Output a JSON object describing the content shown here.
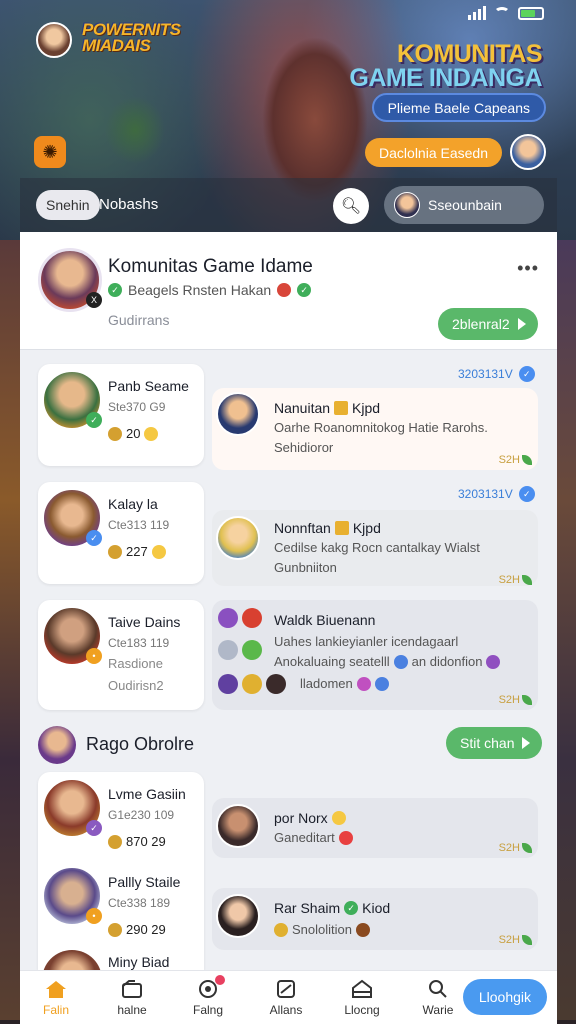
{
  "header": {
    "logo": "POWERNITS MIADAIS",
    "title_line1": "KOMUNITAS",
    "title_line2": "GAME INDANGA",
    "pill_blue": "Plieme Baele Capeans",
    "pill_orange": "Daclolnia Easedn"
  },
  "search": {
    "chip": "Snehin",
    "text": "Nobashs",
    "pill": "Sseounbain"
  },
  "group": {
    "title": "Komunitas Game Idame",
    "subtitle": "Beagels Rnsten Hakan",
    "category": "Gudirrans",
    "button": "2blenral2"
  },
  "members": [
    {
      "name": "Panb Seame",
      "meta": "Ste370 G9",
      "stat": "20"
    },
    {
      "name": "Kalay la",
      "meta": "Cte313 119",
      "stat": "227"
    },
    {
      "name": "Taive Dains",
      "meta": "Cte183 119",
      "meta2": "Rasdione",
      "meta3": "Oudirisn2"
    }
  ],
  "messages": [
    {
      "time": "3203131V",
      "title": "Nanuitan",
      "tag": "Kjpd",
      "body1": "Oarhe Roanomnitokog Hatie Rarohs.",
      "body2": "Sehidioror",
      "mini": "S2H"
    },
    {
      "time": "3203131V",
      "title": "Nonnftan",
      "tag": "Kjpd",
      "body1": "Cedilse kakg Rocn cantalkay Wialst",
      "body2": "Gunbniiton",
      "mini": "S2H"
    },
    {
      "title": "Waldk Biuenann",
      "body1": "Uahes lankieyianler icendagaarl",
      "body2": "Anokaluaing seatelll",
      "body2b": "an didonfion",
      "body3": "lladomen",
      "mini": "S2H"
    }
  ],
  "section": {
    "title": "Rago Obrolre",
    "button": "Stit chan"
  },
  "members2": [
    {
      "name": "Lvme Gasiin",
      "meta": "G1e230 109",
      "stat": "870 29"
    },
    {
      "name": "Pallly Staile",
      "meta": "Cte338 189",
      "stat": "290 29"
    },
    {
      "name": "Miny Biad"
    }
  ],
  "messages2": [
    {
      "title": "por Norx",
      "body": "Ganeditart",
      "mini": "S2H"
    },
    {
      "title": "Rar Shaim",
      "tag": "Kiod",
      "body": "Snololition",
      "mini": "S2H"
    }
  ],
  "nav": {
    "items": [
      "Falin",
      "halne",
      "Falng",
      "Allans",
      "Llocng",
      "Warie"
    ],
    "cta": "Lloohgik"
  },
  "colors": {
    "accent_green": "#5ab86a",
    "accent_blue": "#4a9af0",
    "accent_orange": "#f3a22a"
  }
}
